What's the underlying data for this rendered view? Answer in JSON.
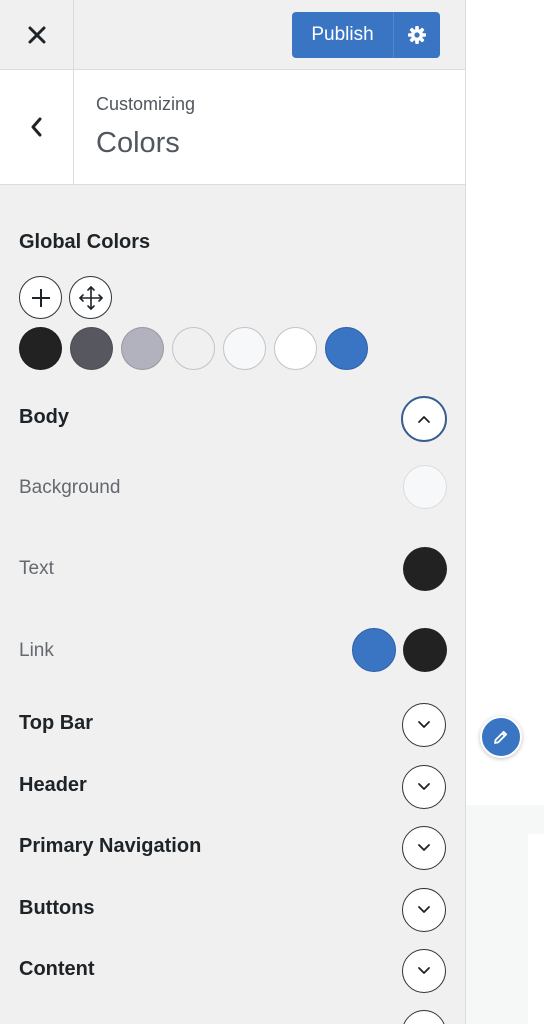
{
  "header": {
    "publish_label": "Publish"
  },
  "section": {
    "subtitle": "Customizing",
    "title": "Colors"
  },
  "global_colors": {
    "title": "Global Colors",
    "swatches": [
      "#222222",
      "#575760",
      "#b2b2be",
      "#f0f0f0",
      "#f7f8f9",
      "#ffffff",
      "#3a75c4"
    ]
  },
  "body_group": {
    "label": "Body",
    "background_label": "Background",
    "background_color": "#f7f8f9",
    "text_label": "Text",
    "text_color": "#222222",
    "link_label": "Link",
    "link_color": "#3a75c4",
    "link_hover_color": "#222222"
  },
  "groups": [
    {
      "label": "Top Bar"
    },
    {
      "label": "Header"
    },
    {
      "label": "Primary Navigation"
    },
    {
      "label": "Buttons"
    },
    {
      "label": "Content"
    }
  ],
  "colors": {
    "accent": "#3a75c4",
    "sidebar_bg": "#f0f0f1"
  }
}
